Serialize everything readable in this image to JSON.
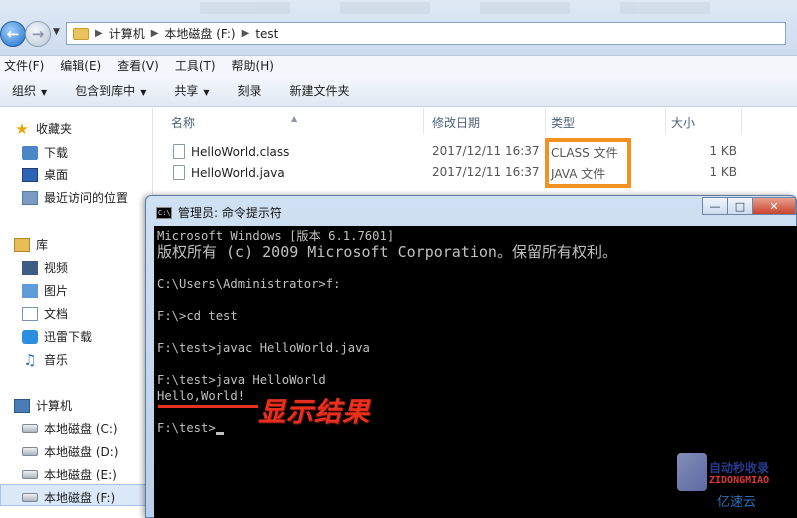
{
  "breadcrumb": [
    "计算机",
    "本地磁盘 (F:)",
    "test"
  ],
  "menu": [
    "文件(F)",
    "编辑(E)",
    "查看(V)",
    "工具(T)",
    "帮助(H)"
  ],
  "toolbar": [
    "组织",
    "包含到库中",
    "共享",
    "刻录",
    "新建文件夹"
  ],
  "sidebar": {
    "favorites": {
      "label": "收藏夹",
      "items": [
        "下载",
        "桌面",
        "最近访问的位置"
      ]
    },
    "libraries": {
      "label": "库",
      "items": [
        "视频",
        "图片",
        "文档",
        "迅雷下载",
        "音乐"
      ]
    },
    "computer": {
      "label": "计算机",
      "items": [
        "本地磁盘 (C:)",
        "本地磁盘 (D:)",
        "本地磁盘 (E:)",
        "本地磁盘 (F:)"
      ]
    }
  },
  "columns": {
    "name": "名称",
    "date": "修改日期",
    "type": "类型",
    "size": "大小"
  },
  "files": [
    {
      "name": "HelloWorld.class",
      "date": "2017/12/11 16:37",
      "type": "CLASS 文件",
      "size": "1 KB"
    },
    {
      "name": "HelloWorld.java",
      "date": "2017/12/11 16:37",
      "type": "JAVA 文件",
      "size": "1 KB"
    }
  ],
  "cmd": {
    "title": "管理员: 命令提示符",
    "lines": [
      "Microsoft Windows [版本 6.1.7601]",
      "版权所有 (c) 2009 Microsoft Corporation。保留所有权利。",
      "",
      "C:\\Users\\Administrator>f:",
      "",
      "F:\\>cd test",
      "",
      "F:\\test>javac HelloWorld.java",
      "",
      "F:\\test>java HelloWorld",
      "Hello,World!",
      "",
      "F:\\test>"
    ]
  },
  "annotation": "显示结果",
  "watermark": {
    "line1": "自动秒收录",
    "line2": "ZIDONGMIAO",
    "line3": "亿速云"
  },
  "colors": {
    "highlight": "#f39223",
    "annotation": "#e8301f"
  }
}
